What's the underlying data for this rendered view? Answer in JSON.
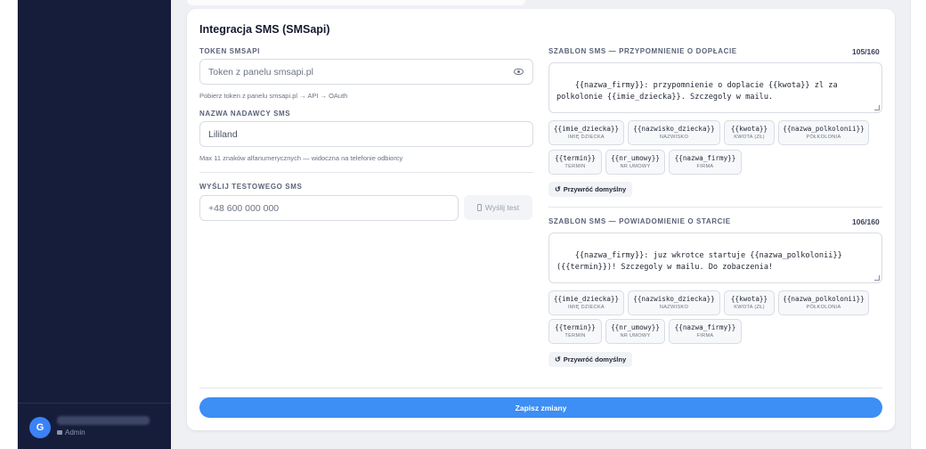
{
  "sidebar": {
    "user": {
      "initial": "G",
      "role": "Admin"
    }
  },
  "card": {
    "title": "Integracja SMS (SMSapi)",
    "token": {
      "label": "TOKEN SMSAPI",
      "placeholder": "Token z panelu smsapi.pl",
      "hint": "Pobierz token z panelu smsapi.pl → API → OAuth"
    },
    "sender": {
      "label": "NAZWA NADAWCY SMS",
      "value": "Lililand",
      "hint": "Max 11 znaków alfanumerycznych — widoczna na telefonie odbiorcy"
    },
    "test": {
      "label": "WYŚLIJ TESTOWEGO SMS",
      "placeholder": "+48 600 000 000",
      "button": "Wyślij test"
    },
    "templates": [
      {
        "label": "SZABLON SMS — PRZYPOMNIENIE O DOPŁACIE",
        "counter": "105/160",
        "text": "{{nazwa_firmy}}: przypomnienie o doplacie {{kwota}} zl za polkolonie {{imie_dziecka}}. Szczegoly w mailu.",
        "reset": "Przywróć domyślny"
      },
      {
        "label": "SZABLON SMS — POWIADOMIENIE O STARCIE",
        "counter": "106/160",
        "text": "{{nazwa_firmy}}: juz wkrotce startuje {{nazwa_polkolonii}} ({{termin}})! Szczegoly w mailu. Do zobaczenia!",
        "reset": "Przywróć domyślny"
      }
    ],
    "variables": [
      {
        "code": "{{imie_dziecka}}",
        "label": "IMIĘ DZIECKA"
      },
      {
        "code": "{{nazwisko_dziecka}}",
        "label": "NAZWISKO"
      },
      {
        "code": "{{kwota}}",
        "label": "KWOTA (ZŁ)"
      },
      {
        "code": "{{nazwa_polkolonii}}",
        "label": "PÓŁKOLONIA"
      },
      {
        "code": "{{termin}}",
        "label": "TERMIN"
      },
      {
        "code": "{{nr_umowy}}",
        "label": "NR UMOWY"
      },
      {
        "code": "{{nazwa_firmy}}",
        "label": "FIRMA"
      }
    ],
    "save_button": "Zapisz zmiany"
  }
}
